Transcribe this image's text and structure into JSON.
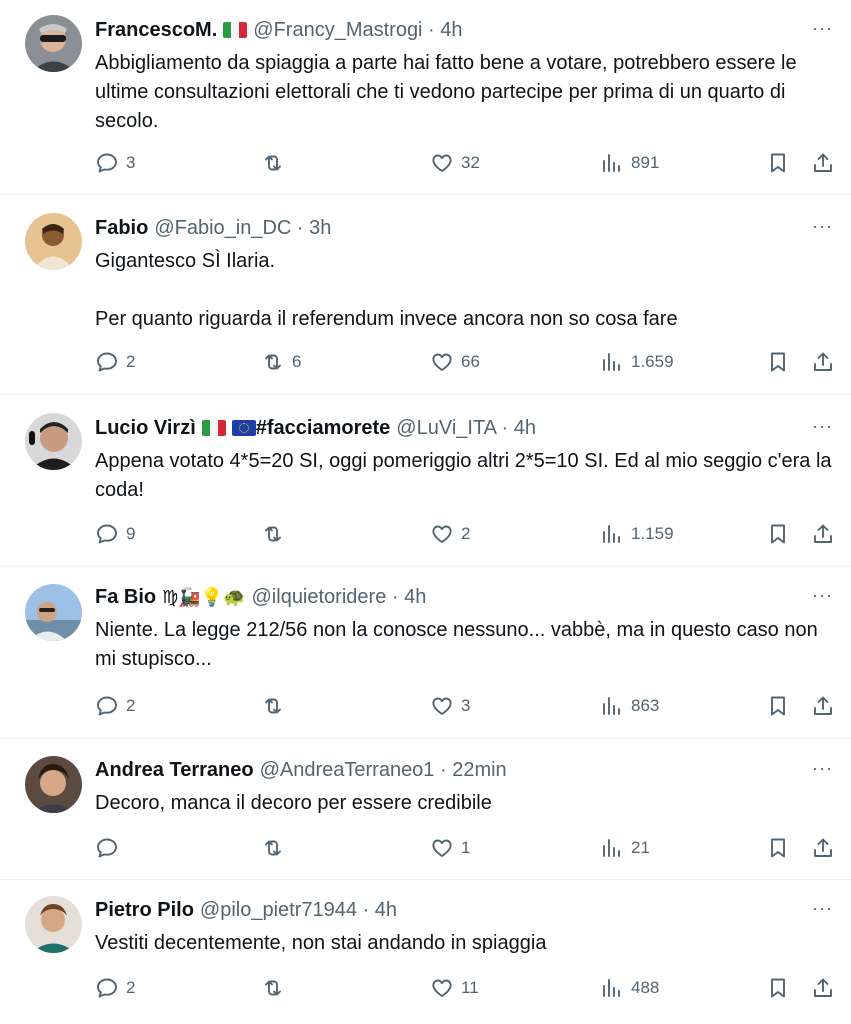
{
  "tweets": [
    {
      "name": "FrancescoM.",
      "handle": "@Francy_Mastrogi · 4h",
      "text": "Abbigliamento da spiaggia a parte hai fatto bene a votare, potrebbero essere le ultime consultazioni elettorali che ti vedono partecipe per prima di un quarto di secolo.",
      "replies": "3",
      "retweets": "",
      "likes": "32",
      "views": "891"
    },
    {
      "name": "Fabio",
      "handle": "@Fabio_in_DC · 3h",
      "text": "Gigantesco SÌ Ilaria.\n\nPer quanto riguarda il referendum invece ancora non so cosa fare",
      "replies": "2",
      "retweets": "6",
      "likes": "66",
      "views": "1.659"
    },
    {
      "name": "Lucio Virzì",
      "name_tag": "#facciamorete",
      "handle": "@LuVi_ITA · 4h",
      "text": "Appena votato 4*5=20 SI, oggi pomeriggio altri 2*5=10 SI. Ed al mio seggio c'era la coda!",
      "replies": "9",
      "retweets": "",
      "likes": "2",
      "views": "1.159"
    },
    {
      "name": "Fa Bio",
      "name_emoji": "♍🚂💡🐢",
      "handle": "@ilquietoridere · 4h",
      "text": "Niente. La legge 212/56 non la conosce nessuno... vabbè, ma in questo caso non mi stupisco...",
      "replies": "2",
      "retweets": "",
      "likes": "3",
      "views": "863"
    },
    {
      "name": "Andrea Terraneo",
      "handle": "@AndreaTerraneo1 · 22min",
      "text": "Decoro, manca il decoro per essere credibile",
      "replies": "",
      "retweets": "",
      "likes": "1",
      "views": "21"
    },
    {
      "name": "Pietro Pilo",
      "handle": "@pilo_pietr71944 · 4h",
      "text": "Vestiti decentemente, non stai andando in spiaggia",
      "replies": "2",
      "retweets": "",
      "likes": "11",
      "views": "488"
    }
  ],
  "more_label": "···",
  "icons": {
    "reply": "reply-icon",
    "retweet": "retweet-icon",
    "like": "heart-icon",
    "views": "views-icon",
    "bookmark": "bookmark-icon",
    "share": "share-icon",
    "more": "more-icon"
  },
  "colors": {
    "text": "#0f1419",
    "secondary": "#536471",
    "divider": "#eff3f4"
  }
}
